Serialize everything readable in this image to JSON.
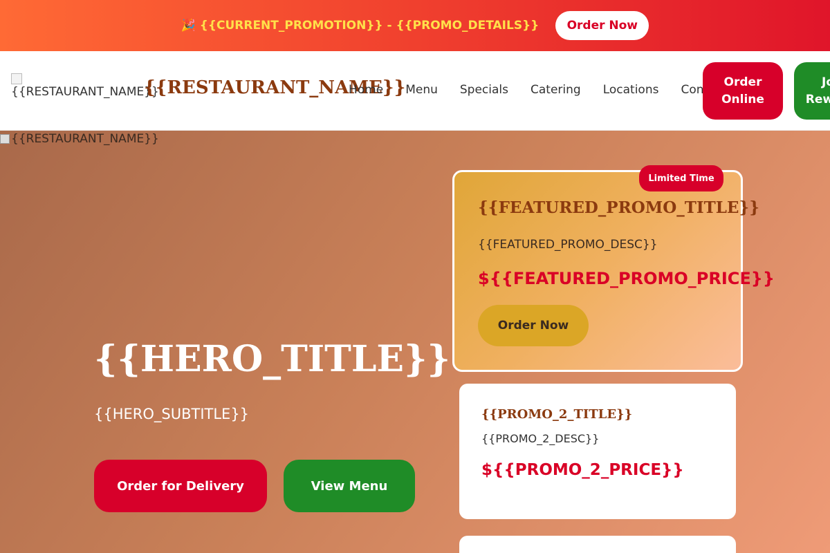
{
  "promo_bar": {
    "icon": "party-popper-icon",
    "text": "🎉 {{CURRENT_PROMOTION}} - {{PROMO_DETAILS}}",
    "button": "Order Now"
  },
  "header": {
    "logo_alt": "{{RESTAURANT_NAME}}",
    "brand": "{{RESTAURANT_NAME}}",
    "nav": [
      "Home",
      "Menu",
      "Specials",
      "Catering",
      "Locations",
      "Contact"
    ],
    "order_online": "Order Online",
    "rewards": "Join Rewards"
  },
  "hero": {
    "image_alt": "{{RESTAURANT_NAME}}",
    "title": "{{HERO_TITLE}}",
    "subtitle": "{{HERO_SUBTITLE}}",
    "cta_delivery": "Order for Delivery",
    "cta_menu": "View Menu"
  },
  "featured": {
    "badge": "Limited Time",
    "title": "{{FEATURED_PROMO_TITLE}}",
    "desc": "{{FEATURED_PROMO_DESC}}",
    "price": "${{FEATURED_PROMO_PRICE}}",
    "button": "Order Now"
  },
  "promo2": {
    "title": "{{PROMO_2_TITLE}}",
    "desc": "{{PROMO_2_DESC}}",
    "price": "${{PROMO_2_PRICE}}"
  },
  "colors": {
    "brand_red": "#d7002a",
    "brand_green": "#1f8c27",
    "brand_brown": "#8b3a0f",
    "promo_yellow": "#ffe14a",
    "gold": "#dba626"
  }
}
